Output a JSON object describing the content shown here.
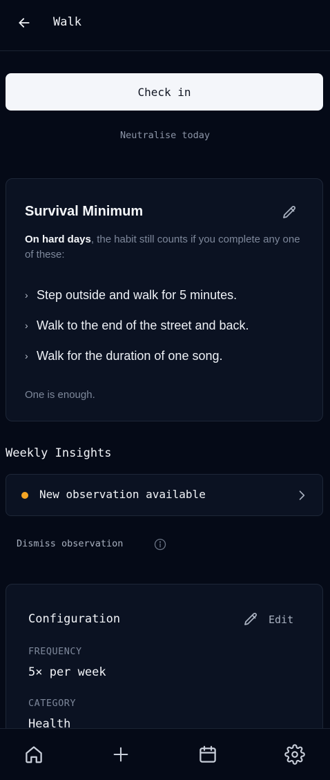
{
  "header": {
    "title": "Walk",
    "back_icon": "arrow-left-icon"
  },
  "actions": {
    "check_in_label": "Check in",
    "neutralise_label": "Neutralise today"
  },
  "survival_minimum": {
    "title": "Survival Minimum",
    "edit_icon": "pencil-icon",
    "description_strong": "On hard days",
    "description_rest": ", the habit still counts if you complete any one of these:",
    "options": [
      "Step outside and walk for 5 minutes.",
      "Walk to the end of the street and back.",
      "Walk for the duration of one song."
    ],
    "footer": "One is enough."
  },
  "weekly_insights": {
    "title": "Weekly Insights",
    "observation_label": "New observation available",
    "observation_dot_color": "#f5a524",
    "dismiss_label": "Dismiss observation"
  },
  "configuration": {
    "title": "Configuration",
    "edit_label": "Edit",
    "frequency_label": "FREQUENCY",
    "frequency_value": "5× per week",
    "category_label": "CATEGORY",
    "category_value": "Health"
  },
  "bottom_nav": {
    "items": [
      "home-icon",
      "plus-icon",
      "calendar-icon",
      "gear-icon"
    ]
  },
  "colors": {
    "background": "#050a17",
    "card": "#0b1222",
    "accent_dot": "#f5a524",
    "button_bg": "#f4f6fa"
  }
}
